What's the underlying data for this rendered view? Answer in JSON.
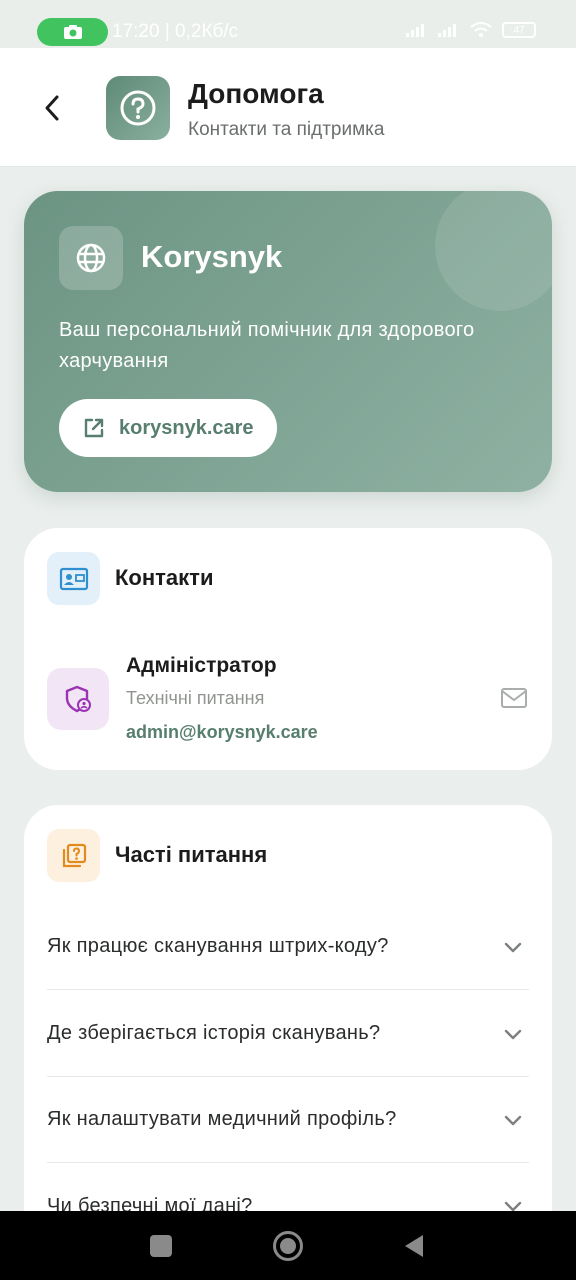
{
  "status_bar": {
    "time": "17:20 | 0,2Кб/с",
    "battery": "47"
  },
  "header": {
    "title": "Допомога",
    "subtitle": "Контакти та підтримка"
  },
  "hero": {
    "title": "Korysnyk",
    "description": "Ваш персональний помічник для здорового харчування",
    "link_label": "korysnyk.care"
  },
  "contacts": {
    "title": "Контакти",
    "items": [
      {
        "name": "Адміністратор",
        "role": "Технічні питання",
        "email": "admin@korysnyk.care"
      }
    ]
  },
  "faq": {
    "title": "Часті питання",
    "items": [
      {
        "question": "Як працює сканування штрих-коду?"
      },
      {
        "question": "Де зберігається історія сканувань?"
      },
      {
        "question": "Як налаштувати медичний профіль?"
      },
      {
        "question": "Чи безпечні мої дані?"
      }
    ]
  },
  "colors": {
    "accent": "#577e6e",
    "hero_gradient_start": "#6c9483",
    "hero_gradient_end": "#8fb1a3",
    "status_pill": "#41c45f"
  },
  "icons": {
    "back": "chevron-left-icon",
    "header_logo": "question-circle-icon",
    "hero": "globe-icon",
    "link": "external-link-icon",
    "contacts": "contact-card-icon",
    "admin": "shield-user-icon",
    "mail": "mail-icon",
    "faq": "question-square-icon",
    "faq_chevron": "chevron-down-icon"
  }
}
